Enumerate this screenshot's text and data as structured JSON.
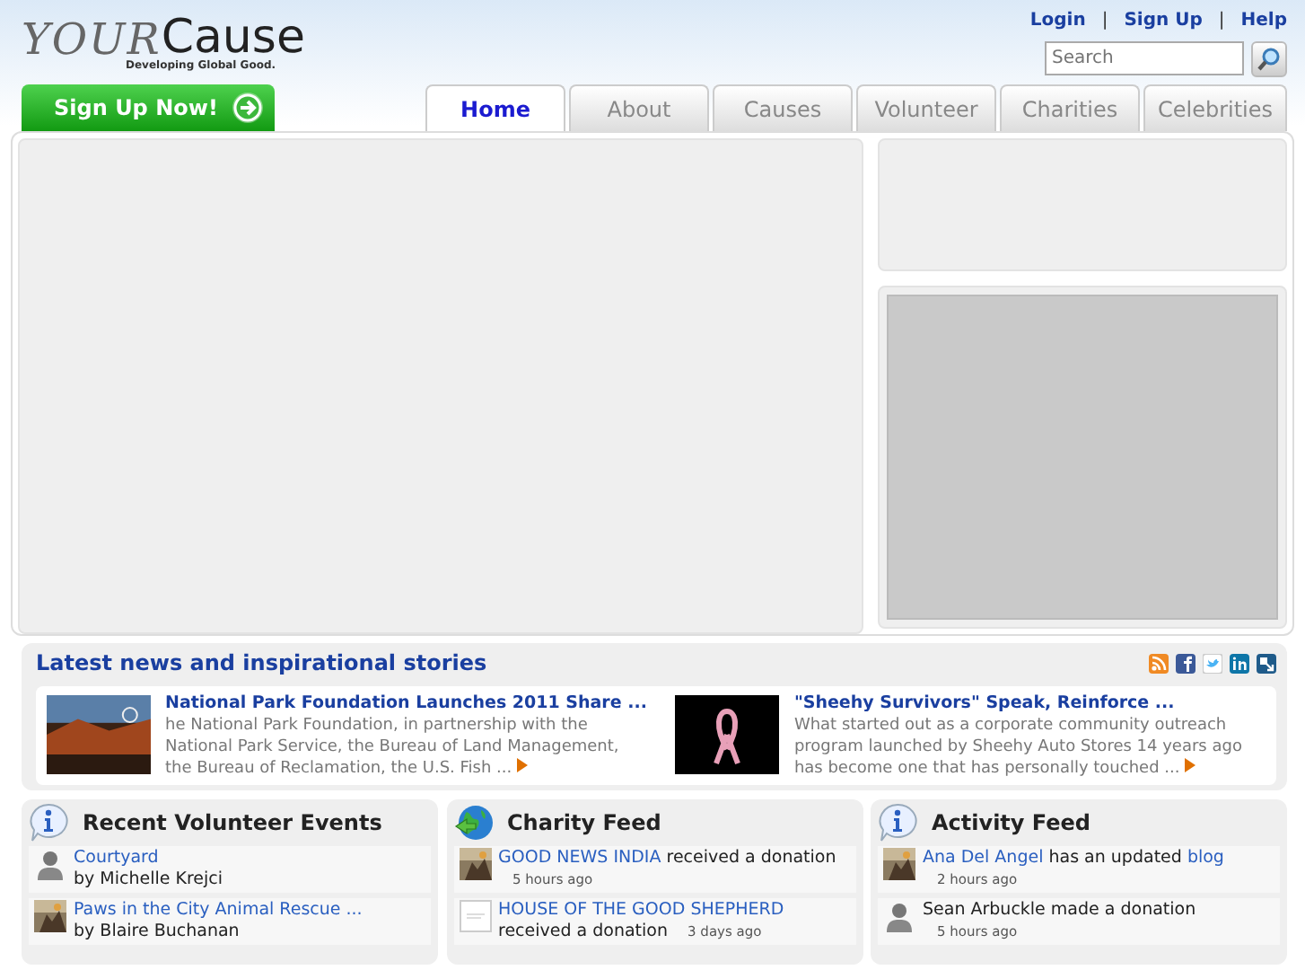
{
  "header": {
    "logo_word": "YOUR",
    "logo_name": "Cause",
    "tagline": "Developing Global Good.",
    "top_links": [
      {
        "kind": "link",
        "text": "Login"
      },
      {
        "kind": "sep",
        "text": "|"
      },
      {
        "kind": "link",
        "text": "Sign Up"
      },
      {
        "kind": "sep",
        "text": "|"
      },
      {
        "kind": "link",
        "text": "Help"
      }
    ],
    "search": {
      "placeholder": "Search"
    },
    "signup_button": "Sign Up Now!"
  },
  "tabs": [
    {
      "label": "Home",
      "selected": true
    },
    {
      "label": "About",
      "selected": false
    },
    {
      "label": "Causes",
      "selected": false
    },
    {
      "label": "Volunteer",
      "selected": false
    },
    {
      "label": "Charities",
      "selected": false
    },
    {
      "label": "Celebrities",
      "selected": false
    }
  ],
  "news": {
    "title": "Latest news and inspirational stories",
    "items": [
      {
        "title": "National Park Foundation Launches 2011 Share ...",
        "text": "he National Park Foundation, in partnership with the National Park Service, the Bureau of Land Management, the Bureau of Reclamation, the U.S. Fish ..."
      },
      {
        "title": "\"Sheehy Survivors\" Speak, Reinforce ...",
        "text": "What started out as a corporate community outreach program launched by Sheehy Auto Stores 14 years ago has become one that has personally touched ..."
      }
    ]
  },
  "feeds": [
    {
      "title": "Recent Volunteer Events",
      "items": [
        {
          "kind": "avatar",
          "segments": [
            {
              "kind": "link",
              "text": "Courtyard"
            }
          ],
          "byline": "by Michelle Krejci"
        },
        {
          "segments": [
            {
              "kind": "link",
              "text": "Paws in the City Animal Rescue ..."
            }
          ],
          "byline": "by Blaire Buchanan"
        }
      ]
    },
    {
      "title": "Charity Feed",
      "items": [
        {
          "segments": [
            {
              "kind": "link",
              "text": "GOOD NEWS INDIA"
            },
            {
              "kind": "plain",
              "text": " received a donation"
            }
          ],
          "time": "5 hours ago"
        },
        {
          "kind": "doc",
          "segments": [
            {
              "kind": "link",
              "text": "HOUSE OF THE GOOD SHEPHERD"
            },
            {
              "kind": "plain",
              "text": " received a donation"
            }
          ],
          "time": "3 days ago"
        }
      ]
    },
    {
      "title": "Activity Feed",
      "items": [
        {
          "segments": [
            {
              "kind": "link",
              "text": "Ana Del Angel"
            },
            {
              "kind": "plain",
              "text": " has an updated "
            },
            {
              "kind": "link",
              "text": "blog"
            }
          ],
          "time": "2 hours ago"
        },
        {
          "kind": "avatar",
          "segments": [
            {
              "kind": "plain",
              "text": "Sean Arbuckle made a donation"
            }
          ],
          "time": "5 hours ago"
        }
      ]
    }
  ]
}
